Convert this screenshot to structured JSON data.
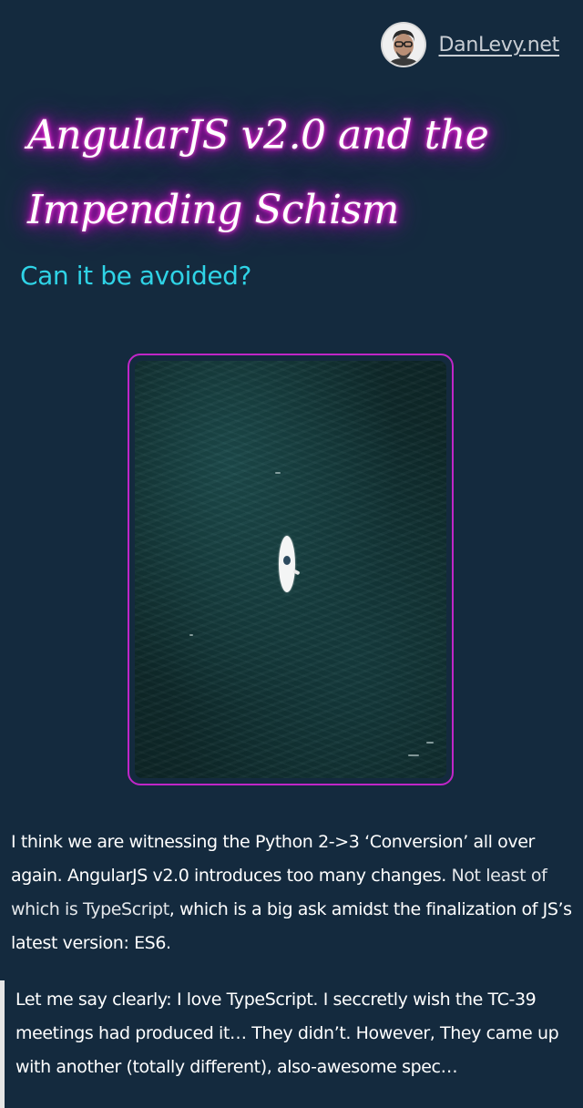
{
  "header": {
    "site_name": "DanLevy.net",
    "avatar_icon": "avatar-photo"
  },
  "article": {
    "title": "AngularJS v2.0 and the Impending Schism",
    "subtitle": "Can it be avoided?",
    "hero_image": "aerial-ocean-paddleboard"
  },
  "content": {
    "paragraph1_a": "I think we are witnessing the Python 2->3 ‘Conversion’ all over again. AngularJS v2.0 introduces too many changes. ",
    "paragraph1_highlight": "Not least of which is TypeScript",
    "paragraph1_b": ", which is a big ask amidst the finalization of JS’s latest version: ES6.",
    "quote": "Let me say clearly: I love TypeScript. I seccretly wish the TC-39 meetings had produced it… They didn’t. However, They came up with another (totally different), also-awesome spec…"
  },
  "colors": {
    "background": "#142a3e",
    "title_glow": "#e100d6",
    "subtitle": "#2fd3e6",
    "frame_border": "#c026c8"
  }
}
